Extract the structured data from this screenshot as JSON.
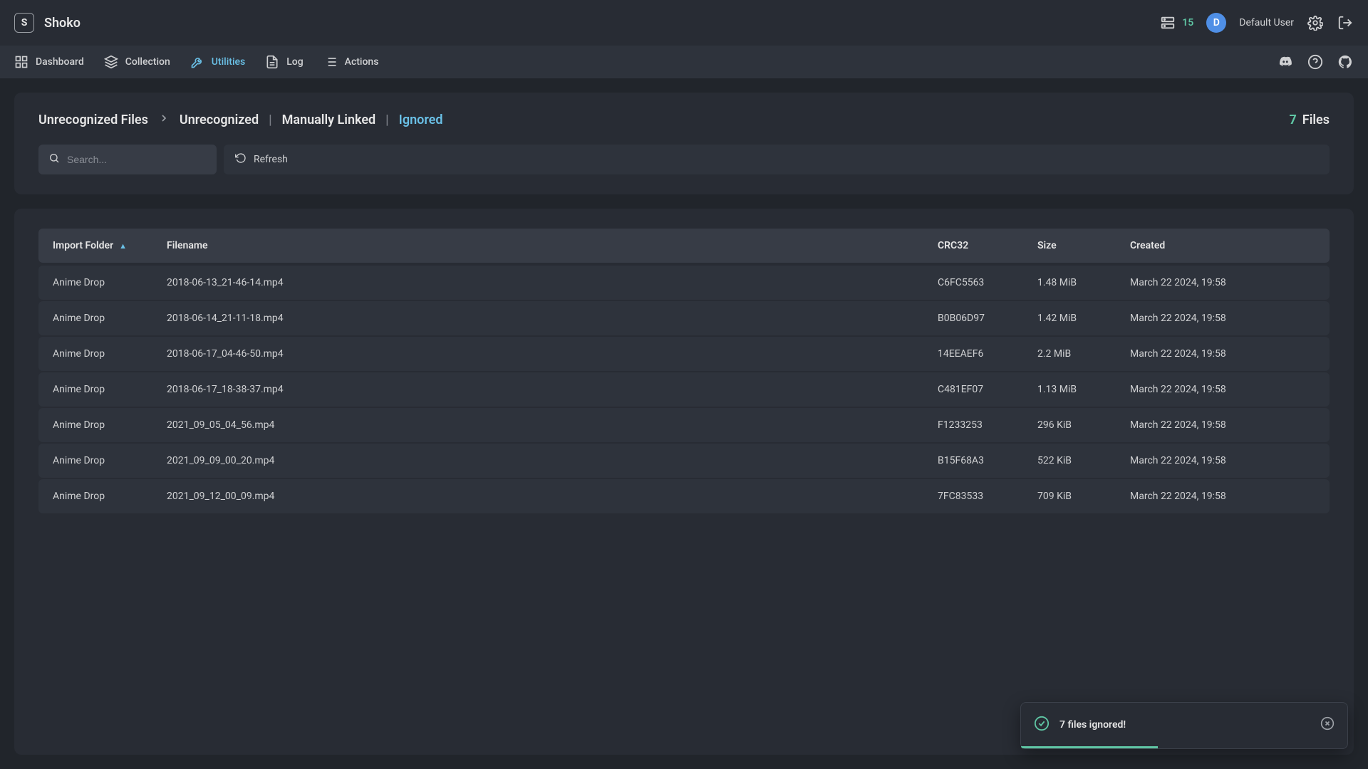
{
  "app": {
    "name": "Shoko",
    "logo_letter": "S"
  },
  "topbar": {
    "queue_count": "15",
    "user_initial": "D",
    "user_name": "Default User"
  },
  "nav": {
    "items": [
      {
        "label": "Dashboard"
      },
      {
        "label": "Collection"
      },
      {
        "label": "Utilities"
      },
      {
        "label": "Log"
      },
      {
        "label": "Actions"
      }
    ]
  },
  "header": {
    "title": "Unrecognized Files",
    "subtabs": [
      {
        "label": "Unrecognized"
      },
      {
        "label": "Manually Linked"
      },
      {
        "label": "Ignored"
      }
    ],
    "divider": "|",
    "files_count": "7",
    "files_label": "Files",
    "search_placeholder": "Search...",
    "refresh_label": "Refresh"
  },
  "table": {
    "columns": {
      "import_folder": "Import Folder",
      "filename": "Filename",
      "crc32": "CRC32",
      "size": "Size",
      "created": "Created"
    },
    "rows": [
      {
        "folder": "Anime Drop",
        "filename": "2018-06-13_21-46-14.mp4",
        "crc32": "C6FC5563",
        "size": "1.48 MiB",
        "created": "March 22 2024, 19:58"
      },
      {
        "folder": "Anime Drop",
        "filename": "2018-06-14_21-11-18.mp4",
        "crc32": "B0B06D97",
        "size": "1.42 MiB",
        "created": "March 22 2024, 19:58"
      },
      {
        "folder": "Anime Drop",
        "filename": "2018-06-17_04-46-50.mp4",
        "crc32": "14EEAEF6",
        "size": "2.2 MiB",
        "created": "March 22 2024, 19:58"
      },
      {
        "folder": "Anime Drop",
        "filename": "2018-06-17_18-38-37.mp4",
        "crc32": "C481EF07",
        "size": "1.13 MiB",
        "created": "March 22 2024, 19:58"
      },
      {
        "folder": "Anime Drop",
        "filename": "2021_09_05_04_56.mp4",
        "crc32": "F1233253",
        "size": "296 KiB",
        "created": "March 22 2024, 19:58"
      },
      {
        "folder": "Anime Drop",
        "filename": "2021_09_09_00_20.mp4",
        "crc32": "B15F68A3",
        "size": "522 KiB",
        "created": "March 22 2024, 19:58"
      },
      {
        "folder": "Anime Drop",
        "filename": "2021_09_12_00_09.mp4",
        "crc32": "7FC83533",
        "size": "709 KiB",
        "created": "March 22 2024, 19:58"
      }
    ]
  },
  "toast": {
    "message": "7 files ignored!"
  }
}
